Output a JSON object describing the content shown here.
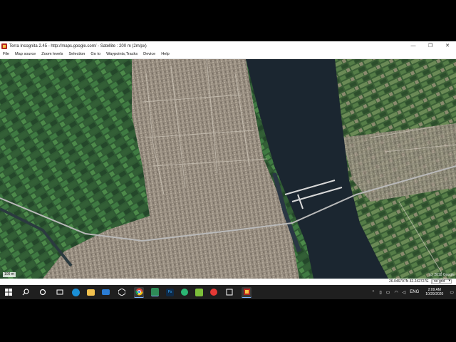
{
  "window": {
    "title": "Terra Incognita 2.45 - http://maps.google.com/ - Satellite : 200 m (2m/px)",
    "controls": {
      "minimize": "—",
      "maximize": "❐",
      "close": "✕"
    }
  },
  "menu": [
    "File",
    "Map source",
    "Zoom levels",
    "Selection",
    "Go to",
    "Waypoints,Tracks",
    "Device",
    "Help"
  ],
  "map": {
    "scale_label": "100 m",
    "copyright": "(c) 2018 Google"
  },
  "status": {
    "coordinates": "26.046797N 32.242727E",
    "grid_option": "no grid"
  },
  "taskbar": {
    "apps": [
      "start",
      "search",
      "cortana",
      "task-view",
      "edge",
      "file-explorer",
      "mail",
      "unity",
      "chrome",
      "excel",
      "photoshop",
      "camtasia",
      "vm",
      "youtube",
      "capture",
      "terra-incognita"
    ],
    "tray_language": "ENG",
    "time": "2:09 AM",
    "date": "10/29/2020"
  }
}
